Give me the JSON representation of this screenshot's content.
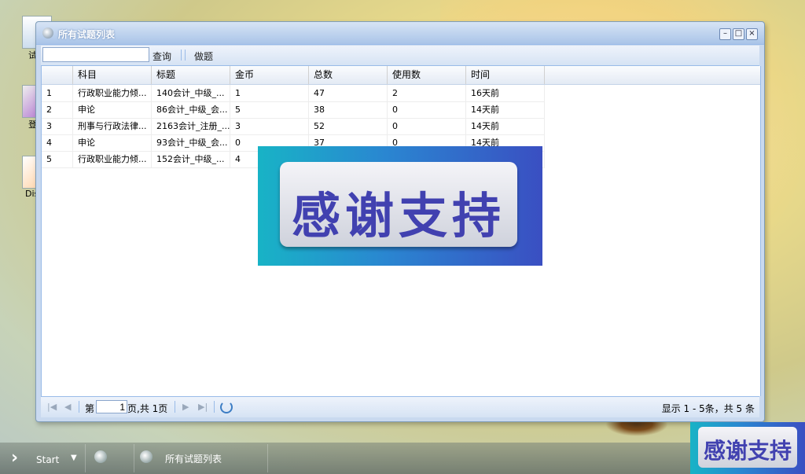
{
  "desktop": {
    "icons": [
      {
        "label": "试题"
      },
      {
        "label": "登录"
      },
      {
        "label": "Disco"
      }
    ]
  },
  "window": {
    "title": "所有试题列表",
    "controls": {
      "minimize": "–",
      "maximize": "□",
      "close": "×"
    }
  },
  "toolbar": {
    "search_value": "",
    "query_label": "查询",
    "practice_label": "做题"
  },
  "grid": {
    "columns": [
      "科目",
      "标题",
      "金币",
      "总数",
      "使用数",
      "时间"
    ],
    "rows": [
      {
        "no": "1",
        "subject": "行政职业能力倾...",
        "title": "140会计_中级_...",
        "coins": "1",
        "total": "47",
        "used": "2",
        "time": "16天前"
      },
      {
        "no": "2",
        "subject": "申论",
        "title": "86会计_中级_会...",
        "coins": "5",
        "total": "38",
        "used": "0",
        "time": "14天前"
      },
      {
        "no": "3",
        "subject": "刑事与行政法律...",
        "title": "2163会计_注册_...",
        "coins": "3",
        "total": "52",
        "used": "0",
        "time": "14天前"
      },
      {
        "no": "4",
        "subject": "申论",
        "title": "93会计_中级_会...",
        "coins": "0",
        "total": "37",
        "used": "0",
        "time": "14天前"
      },
      {
        "no": "5",
        "subject": "行政职业能力倾...",
        "title": "152会计_中级_...",
        "coins": "4",
        "total": "",
        "used": "",
        "time": ""
      }
    ]
  },
  "pager": {
    "page_prefix": "第",
    "page_value": "1",
    "page_suffix": "页,共 1页",
    "display_text": "显示 1 - 5条，共 5 条"
  },
  "banner": {
    "text": "感谢支持"
  },
  "taskbar": {
    "start_label": "Start",
    "active_task_label": "所有试题列表"
  },
  "colors": {
    "window_border": "#7f9db9",
    "header_blue": "#a9c4e8",
    "banner_text": "#4141b0"
  }
}
